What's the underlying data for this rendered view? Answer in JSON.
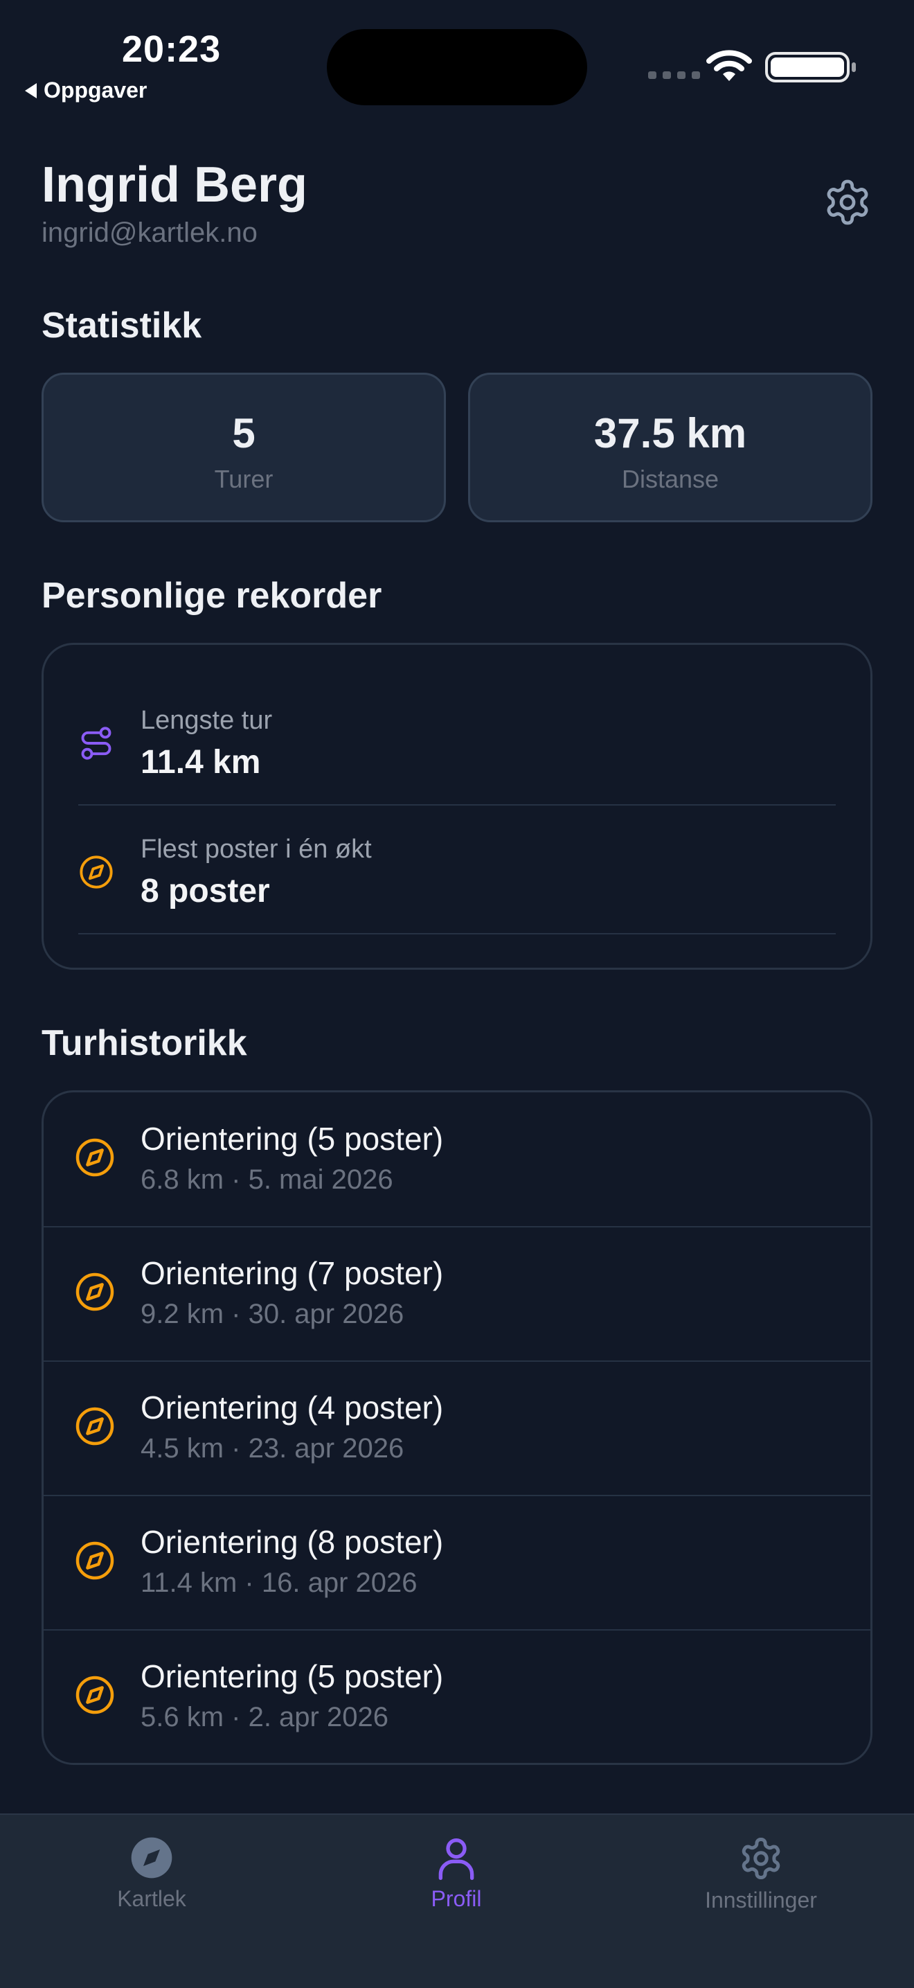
{
  "status_bar": {
    "time": "20:23",
    "back_label": "Oppgaver"
  },
  "profile": {
    "name": "Ingrid Berg",
    "email": "ingrid@kartlek.no",
    "settings_icon": "gear-icon"
  },
  "stats": {
    "title": "Statistikk",
    "cards": [
      {
        "value": "5",
        "label": "Turer"
      },
      {
        "value": "37.5 km",
        "label": "Distanse"
      }
    ]
  },
  "records": {
    "title": "Personlige rekorder",
    "items": [
      {
        "icon": "route-icon",
        "label": "Lengste tur",
        "value": "11.4 km"
      },
      {
        "icon": "compass-icon",
        "label": "Flest poster i én økt",
        "value": "8 poster"
      }
    ]
  },
  "history": {
    "title": "Turhistorikk",
    "items": [
      {
        "title": "Orientering (5 poster)",
        "subtitle": "6.8 km · 5. mai 2026"
      },
      {
        "title": "Orientering (7 poster)",
        "subtitle": "9.2 km · 30. apr 2026"
      },
      {
        "title": "Orientering (4 poster)",
        "subtitle": "4.5 km · 23. apr 2026"
      },
      {
        "title": "Orientering (8 poster)",
        "subtitle": "11.4 km · 16. apr 2026"
      },
      {
        "title": "Orientering (5 poster)",
        "subtitle": "5.6 km · 2. apr 2026"
      }
    ]
  },
  "tabbar": {
    "tabs": [
      {
        "label": "Kartlek",
        "icon": "compass-icon",
        "active": false
      },
      {
        "label": "Profil",
        "icon": "person-icon",
        "active": true
      },
      {
        "label": "Innstillinger",
        "icon": "gear-icon",
        "active": false
      }
    ]
  },
  "colors": {
    "background": "#111827",
    "accent": "#8b5cf6",
    "compass": "#f59e0b",
    "card": "#1e293b"
  }
}
